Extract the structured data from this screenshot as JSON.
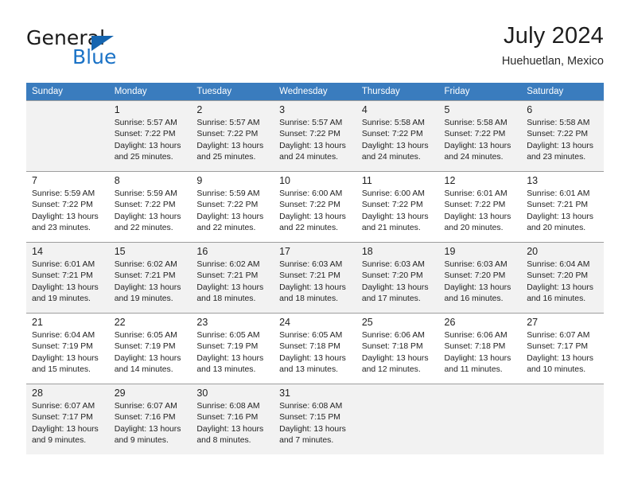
{
  "brand": {
    "name_top": "General",
    "name_bottom": "Blue",
    "accent_color": "#1a72c6",
    "triangle_color": "#1565b0"
  },
  "header": {
    "title": "July 2024",
    "subtitle": "Huehuetlan, Mexico"
  },
  "theme": {
    "header_row_bg": "#3a7cbe",
    "header_row_text": "#ffffff",
    "alt_row_bg": "#f2f2f2",
    "row_bg": "#ffffff",
    "grid_line": "#9e9e9e"
  },
  "weekday_headers": [
    "Sunday",
    "Monday",
    "Tuesday",
    "Wednesday",
    "Thursday",
    "Friday",
    "Saturday"
  ],
  "weeks": [
    [
      {
        "day": "",
        "info": ""
      },
      {
        "day": "1",
        "info": "Sunrise: 5:57 AM\nSunset: 7:22 PM\nDaylight: 13 hours\nand 25 minutes."
      },
      {
        "day": "2",
        "info": "Sunrise: 5:57 AM\nSunset: 7:22 PM\nDaylight: 13 hours\nand 25 minutes."
      },
      {
        "day": "3",
        "info": "Sunrise: 5:57 AM\nSunset: 7:22 PM\nDaylight: 13 hours\nand 24 minutes."
      },
      {
        "day": "4",
        "info": "Sunrise: 5:58 AM\nSunset: 7:22 PM\nDaylight: 13 hours\nand 24 minutes."
      },
      {
        "day": "5",
        "info": "Sunrise: 5:58 AM\nSunset: 7:22 PM\nDaylight: 13 hours\nand 24 minutes."
      },
      {
        "day": "6",
        "info": "Sunrise: 5:58 AM\nSunset: 7:22 PM\nDaylight: 13 hours\nand 23 minutes."
      }
    ],
    [
      {
        "day": "7",
        "info": "Sunrise: 5:59 AM\nSunset: 7:22 PM\nDaylight: 13 hours\nand 23 minutes."
      },
      {
        "day": "8",
        "info": "Sunrise: 5:59 AM\nSunset: 7:22 PM\nDaylight: 13 hours\nand 22 minutes."
      },
      {
        "day": "9",
        "info": "Sunrise: 5:59 AM\nSunset: 7:22 PM\nDaylight: 13 hours\nand 22 minutes."
      },
      {
        "day": "10",
        "info": "Sunrise: 6:00 AM\nSunset: 7:22 PM\nDaylight: 13 hours\nand 22 minutes."
      },
      {
        "day": "11",
        "info": "Sunrise: 6:00 AM\nSunset: 7:22 PM\nDaylight: 13 hours\nand 21 minutes."
      },
      {
        "day": "12",
        "info": "Sunrise: 6:01 AM\nSunset: 7:22 PM\nDaylight: 13 hours\nand 20 minutes."
      },
      {
        "day": "13",
        "info": "Sunrise: 6:01 AM\nSunset: 7:21 PM\nDaylight: 13 hours\nand 20 minutes."
      }
    ],
    [
      {
        "day": "14",
        "info": "Sunrise: 6:01 AM\nSunset: 7:21 PM\nDaylight: 13 hours\nand 19 minutes."
      },
      {
        "day": "15",
        "info": "Sunrise: 6:02 AM\nSunset: 7:21 PM\nDaylight: 13 hours\nand 19 minutes."
      },
      {
        "day": "16",
        "info": "Sunrise: 6:02 AM\nSunset: 7:21 PM\nDaylight: 13 hours\nand 18 minutes."
      },
      {
        "day": "17",
        "info": "Sunrise: 6:03 AM\nSunset: 7:21 PM\nDaylight: 13 hours\nand 18 minutes."
      },
      {
        "day": "18",
        "info": "Sunrise: 6:03 AM\nSunset: 7:20 PM\nDaylight: 13 hours\nand 17 minutes."
      },
      {
        "day": "19",
        "info": "Sunrise: 6:03 AM\nSunset: 7:20 PM\nDaylight: 13 hours\nand 16 minutes."
      },
      {
        "day": "20",
        "info": "Sunrise: 6:04 AM\nSunset: 7:20 PM\nDaylight: 13 hours\nand 16 minutes."
      }
    ],
    [
      {
        "day": "21",
        "info": "Sunrise: 6:04 AM\nSunset: 7:19 PM\nDaylight: 13 hours\nand 15 minutes."
      },
      {
        "day": "22",
        "info": "Sunrise: 6:05 AM\nSunset: 7:19 PM\nDaylight: 13 hours\nand 14 minutes."
      },
      {
        "day": "23",
        "info": "Sunrise: 6:05 AM\nSunset: 7:19 PM\nDaylight: 13 hours\nand 13 minutes."
      },
      {
        "day": "24",
        "info": "Sunrise: 6:05 AM\nSunset: 7:18 PM\nDaylight: 13 hours\nand 13 minutes."
      },
      {
        "day": "25",
        "info": "Sunrise: 6:06 AM\nSunset: 7:18 PM\nDaylight: 13 hours\nand 12 minutes."
      },
      {
        "day": "26",
        "info": "Sunrise: 6:06 AM\nSunset: 7:18 PM\nDaylight: 13 hours\nand 11 minutes."
      },
      {
        "day": "27",
        "info": "Sunrise: 6:07 AM\nSunset: 7:17 PM\nDaylight: 13 hours\nand 10 minutes."
      }
    ],
    [
      {
        "day": "28",
        "info": "Sunrise: 6:07 AM\nSunset: 7:17 PM\nDaylight: 13 hours\nand 9 minutes."
      },
      {
        "day": "29",
        "info": "Sunrise: 6:07 AM\nSunset: 7:16 PM\nDaylight: 13 hours\nand 9 minutes."
      },
      {
        "day": "30",
        "info": "Sunrise: 6:08 AM\nSunset: 7:16 PM\nDaylight: 13 hours\nand 8 minutes."
      },
      {
        "day": "31",
        "info": "Sunrise: 6:08 AM\nSunset: 7:15 PM\nDaylight: 13 hours\nand 7 minutes."
      },
      {
        "day": "",
        "info": ""
      },
      {
        "day": "",
        "info": ""
      },
      {
        "day": "",
        "info": ""
      }
    ]
  ]
}
